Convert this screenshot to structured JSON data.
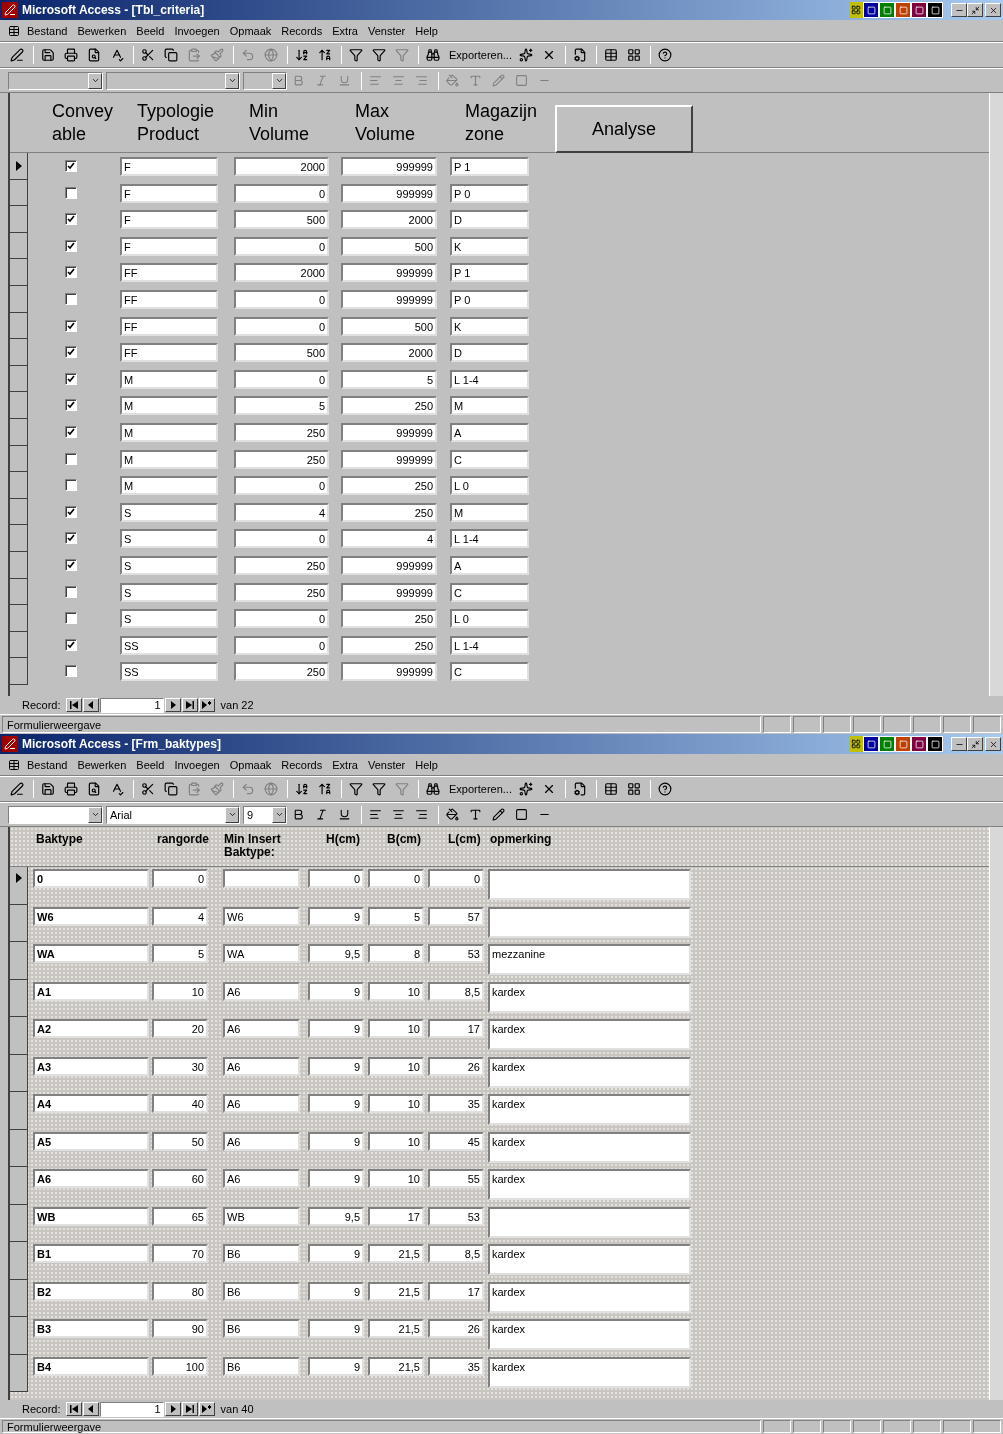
{
  "windows": [
    {
      "kind": "criteria",
      "title": "Microsoft Access - [Tbl_criteria]",
      "menu": [
        "Bestand",
        "Bewerken",
        "Beeld",
        "Invoegen",
        "Opmaak",
        "Records",
        "Extra",
        "Venster",
        "Help"
      ],
      "export_label": "Exporteren...",
      "format_bar": {
        "enabled": false
      },
      "form": {
        "headers": [
          [
            "Convey",
            "able"
          ],
          [
            "Typologie",
            "Product"
          ],
          [
            "Min",
            "Volume"
          ],
          [
            "Max",
            "Volume"
          ],
          [
            "Magazijn",
            "zone"
          ]
        ],
        "action_button": "Analyse",
        "rows": [
          {
            "selected": true,
            "conveyable": true,
            "typologie": "F",
            "min": "2000",
            "max": "999999",
            "zone": "P 1"
          },
          {
            "selected": false,
            "conveyable": false,
            "typologie": "F",
            "min": "0",
            "max": "999999",
            "zone": "P 0"
          },
          {
            "selected": false,
            "conveyable": true,
            "typologie": "F",
            "min": "500",
            "max": "2000",
            "zone": "D"
          },
          {
            "selected": false,
            "conveyable": true,
            "typologie": "F",
            "min": "0",
            "max": "500",
            "zone": "K"
          },
          {
            "selected": false,
            "conveyable": true,
            "typologie": "FF",
            "min": "2000",
            "max": "999999",
            "zone": "P 1"
          },
          {
            "selected": false,
            "conveyable": false,
            "typologie": "FF",
            "min": "0",
            "max": "999999",
            "zone": "P 0"
          },
          {
            "selected": false,
            "conveyable": true,
            "typologie": "FF",
            "min": "0",
            "max": "500",
            "zone": "K"
          },
          {
            "selected": false,
            "conveyable": true,
            "typologie": "FF",
            "min": "500",
            "max": "2000",
            "zone": "D"
          },
          {
            "selected": false,
            "conveyable": true,
            "typologie": "M",
            "min": "0",
            "max": "5",
            "zone": "L 1-4"
          },
          {
            "selected": false,
            "conveyable": true,
            "typologie": "M",
            "min": "5",
            "max": "250",
            "zone": "M"
          },
          {
            "selected": false,
            "conveyable": true,
            "typologie": "M",
            "min": "250",
            "max": "999999",
            "zone": "A"
          },
          {
            "selected": false,
            "conveyable": false,
            "typologie": "M",
            "min": "250",
            "max": "999999",
            "zone": "C"
          },
          {
            "selected": false,
            "conveyable": false,
            "typologie": "M",
            "min": "0",
            "max": "250",
            "zone": "L 0"
          },
          {
            "selected": false,
            "conveyable": true,
            "typologie": "S",
            "min": "4",
            "max": "250",
            "zone": "M"
          },
          {
            "selected": false,
            "conveyable": true,
            "typologie": "S",
            "min": "0",
            "max": "4",
            "zone": "L 1-4"
          },
          {
            "selected": false,
            "conveyable": true,
            "typologie": "S",
            "min": "250",
            "max": "999999",
            "zone": "A"
          },
          {
            "selected": false,
            "conveyable": false,
            "typologie": "S",
            "min": "250",
            "max": "999999",
            "zone": "C"
          },
          {
            "selected": false,
            "conveyable": false,
            "typologie": "S",
            "min": "0",
            "max": "250",
            "zone": "L 0"
          },
          {
            "selected": false,
            "conveyable": true,
            "typologie": "SS",
            "min": "0",
            "max": "250",
            "zone": "L 1-4"
          },
          {
            "selected": false,
            "conveyable": false,
            "typologie": "SS",
            "min": "250",
            "max": "999999",
            "zone": "C"
          }
        ]
      },
      "navigator": {
        "label": "Record:",
        "current": "1",
        "total": "van 22"
      },
      "status": "Formulierweergave"
    },
    {
      "kind": "baktypes",
      "title": "Microsoft Access - [Frm_baktypes]",
      "menu": [
        "Bestand",
        "Bewerken",
        "Beeld",
        "Invoegen",
        "Opmaak",
        "Records",
        "Extra",
        "Venster",
        "Help"
      ],
      "export_label": "Exporteren...",
      "format_bar": {
        "enabled": true,
        "font": "Arial",
        "size": "9"
      },
      "form": {
        "headers": [
          [
            "Baktype"
          ],
          [
            "rangorde"
          ],
          [
            "Min Insert",
            "Baktype:"
          ],
          [
            "H(cm)"
          ],
          [
            "B(cm)"
          ],
          [
            "L(cm)"
          ],
          [
            "opmerking"
          ]
        ],
        "rows": [
          {
            "selected": true,
            "baktype": "0",
            "rangorde": "0",
            "h": "0",
            "b": "0",
            "l": "0"
          },
          {
            "selected": false,
            "baktype": "W6",
            "rangorde": "4",
            "insert": "W6",
            "h": "9",
            "b": "5",
            "l": "57"
          },
          {
            "selected": false,
            "baktype": "WA",
            "rangorde": "5",
            "insert": "WA",
            "h": "9,5",
            "b": "8",
            "l": "53",
            "opmerking": "mezzanine"
          },
          {
            "selected": false,
            "baktype": "A1",
            "rangorde": "10",
            "insert": "A6",
            "h": "9",
            "b": "10",
            "l": "8,5",
            "opmerking": "kardex"
          },
          {
            "selected": false,
            "baktype": "A2",
            "rangorde": "20",
            "insert": "A6",
            "h": "9",
            "b": "10",
            "l": "17",
            "opmerking": "kardex"
          },
          {
            "selected": false,
            "baktype": "A3",
            "rangorde": "30",
            "insert": "A6",
            "h": "9",
            "b": "10",
            "l": "26",
            "opmerking": "kardex"
          },
          {
            "selected": false,
            "baktype": "A4",
            "rangorde": "40",
            "insert": "A6",
            "h": "9",
            "b": "10",
            "l": "35",
            "opmerking": "kardex"
          },
          {
            "selected": false,
            "baktype": "A5",
            "rangorde": "50",
            "insert": "A6",
            "h": "9",
            "b": "10",
            "l": "45",
            "opmerking": "kardex"
          },
          {
            "selected": false,
            "baktype": "A6",
            "rangorde": "60",
            "insert": "A6",
            "h": "9",
            "b": "10",
            "l": "55",
            "opmerking": "kardex"
          },
          {
            "selected": false,
            "baktype": "WB",
            "rangorde": "65",
            "insert": "WB",
            "h": "9,5",
            "b": "17",
            "l": "53"
          },
          {
            "selected": false,
            "baktype": "B1",
            "rangorde": "70",
            "insert": "B6",
            "h": "9",
            "b": "21,5",
            "l": "8,5",
            "opmerking": "kardex"
          },
          {
            "selected": false,
            "baktype": "B2",
            "rangorde": "80",
            "insert": "B6",
            "h": "9",
            "b": "21,5",
            "l": "17",
            "opmerking": "kardex"
          },
          {
            "selected": false,
            "baktype": "B3",
            "rangorde": "90",
            "insert": "B6",
            "h": "9",
            "b": "21,5",
            "l": "26",
            "opmerking": "kardex"
          },
          {
            "selected": false,
            "baktype": "B4",
            "rangorde": "100",
            "insert": "B6",
            "h": "9",
            "b": "21,5",
            "l": "35",
            "opmerking": "kardex"
          }
        ]
      },
      "navigator": {
        "label": "Record:",
        "current": "1",
        "total": "van 40"
      },
      "status": "Formulierweergave"
    }
  ]
}
